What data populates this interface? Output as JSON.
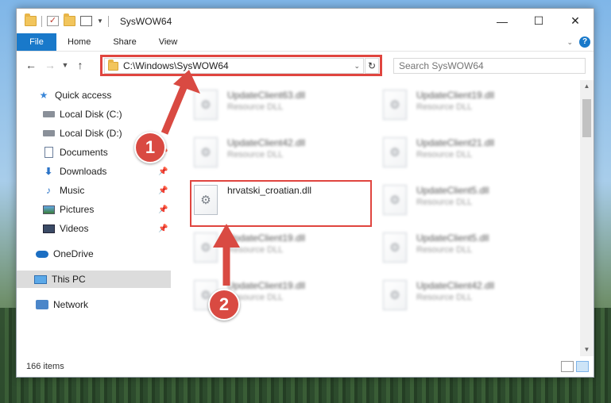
{
  "window": {
    "title": "SysWOW64",
    "controls": {
      "minimize": "—",
      "maximize": "☐",
      "close": "✕"
    }
  },
  "ribbon": {
    "tabs": [
      "File",
      "Home",
      "Share",
      "View"
    ]
  },
  "nav": {
    "address": "C:\\Windows\\SysWOW64",
    "search_placeholder": "Search SysWOW64"
  },
  "sidebar": {
    "items": [
      {
        "label": "Quick access"
      },
      {
        "label": "Local Disk (C:)"
      },
      {
        "label": "Local Disk (D:)"
      },
      {
        "label": "Documents"
      },
      {
        "label": "Downloads"
      },
      {
        "label": "Music"
      },
      {
        "label": "Pictures"
      },
      {
        "label": "Videos"
      },
      {
        "label": "OneDrive"
      },
      {
        "label": "This PC"
      },
      {
        "label": "Network"
      }
    ]
  },
  "files": [
    {
      "name": "UpdateClient63.dll",
      "type": "Resource DLL"
    },
    {
      "name": "UpdateClient19.dll",
      "type": "Resource DLL"
    },
    {
      "name": "UpdateClient42.dll",
      "type": "Resource DLL"
    },
    {
      "name": "UpdateClient21.dll",
      "type": "Resource DLL"
    },
    {
      "name": "hrvatski_croatian.dll",
      "type": ""
    },
    {
      "name": "UpdateClient5.dll",
      "type": "Resource DLL"
    },
    {
      "name": "UpdateClient19.dll",
      "type": "Resource DLL"
    },
    {
      "name": "UpdateClient5.dll",
      "type": "Resource DLL"
    },
    {
      "name": "UpdateClient19.dll",
      "type": "Resource DLL"
    },
    {
      "name": "UpdateClient42.dll",
      "type": "Resource DLL"
    }
  ],
  "status": {
    "item_count": "166 items"
  },
  "markers": {
    "one": "1",
    "two": "2"
  },
  "colors": {
    "annotation_red": "#e0453f",
    "file_tab_blue": "#1979ca"
  }
}
